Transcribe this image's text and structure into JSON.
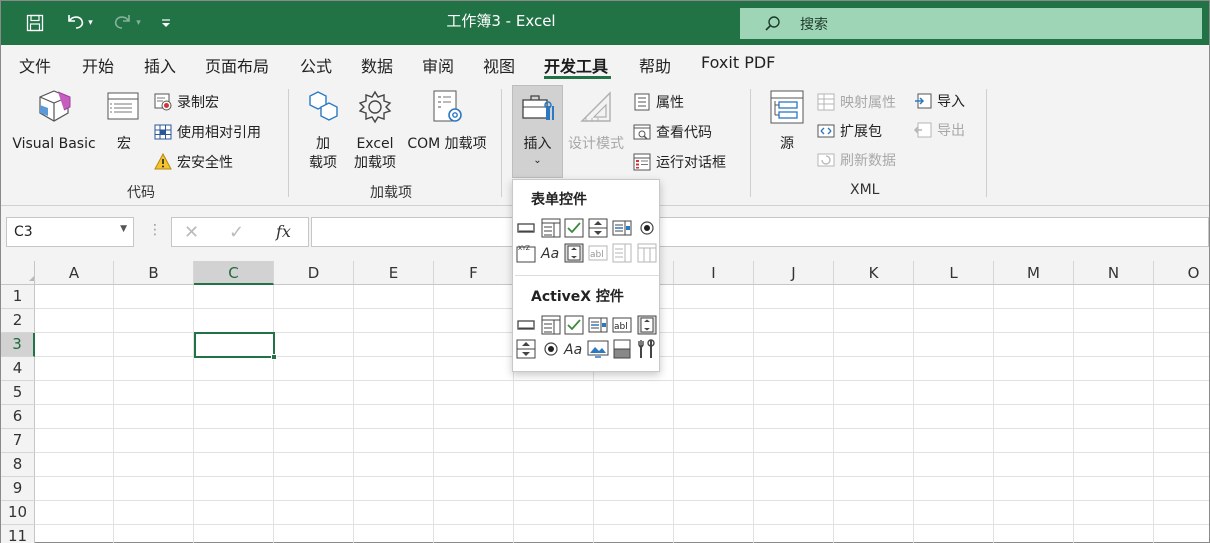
{
  "titlebar": {
    "title": "工作簿3 - Excel",
    "search_placeholder": "搜索",
    "accent": "#217346"
  },
  "tabs": [
    "文件",
    "开始",
    "插入",
    "页面布局",
    "公式",
    "数据",
    "审阅",
    "视图",
    "开发工具",
    "帮助",
    "Foxit PDF"
  ],
  "active_tab": "开发工具",
  "ribbon": {
    "code": {
      "label": "代码",
      "visual_basic": "Visual Basic",
      "macros": "宏",
      "record_macro": "录制宏",
      "relative_refs": "使用相对引用",
      "macro_security": "宏安全性"
    },
    "addins": {
      "label": "加载项",
      "addins_line1": "加",
      "addins_line2": "载项",
      "excel_addins_line1": "Excel",
      "excel_addins_line2": "加载项",
      "com_addins": "COM 加载项"
    },
    "controls": {
      "insert": "插入",
      "design_mode": "设计模式",
      "properties": "属性",
      "view_code": "查看代码",
      "run_dialog": "运行对话框"
    },
    "xml": {
      "label": "XML",
      "source": "源",
      "map_properties": "映射属性",
      "expansion_packs": "扩展包",
      "refresh_data": "刷新数据",
      "import": "导入",
      "export": "导出"
    }
  },
  "formula_bar": {
    "name_box": "C3",
    "fx": "fx",
    "formula": ""
  },
  "grid": {
    "columns": [
      "A",
      "B",
      "C",
      "D",
      "E",
      "F",
      "G",
      "H",
      "I",
      "J",
      "K",
      "L",
      "M",
      "N",
      "O"
    ],
    "rows": [
      "1",
      "2",
      "3",
      "4",
      "5",
      "6",
      "7",
      "8",
      "9",
      "10",
      "11"
    ],
    "selected_cell": "C3"
  },
  "dropdown": {
    "form_controls_heading": "表单控件",
    "activex_heading": "ActiveX 控件",
    "form_controls": [
      "button-icon",
      "combo-box-icon",
      "checkbox-icon",
      "spin-button-icon",
      "list-box-icon",
      "option-button-icon",
      "group-box-icon",
      "label-icon",
      "scroll-bar-icon",
      "text-field-icon",
      "combo-list-edit-icon",
      "combo-dropdown-edit-icon"
    ],
    "activex_controls": [
      "button-icon",
      "combo-box-icon",
      "checkbox-icon",
      "list-box-icon",
      "text-box-icon",
      "scroll-bar-icon",
      "spin-button-icon",
      "option-button-icon",
      "label-icon",
      "image-icon",
      "toggle-button-icon",
      "more-controls-icon"
    ]
  }
}
